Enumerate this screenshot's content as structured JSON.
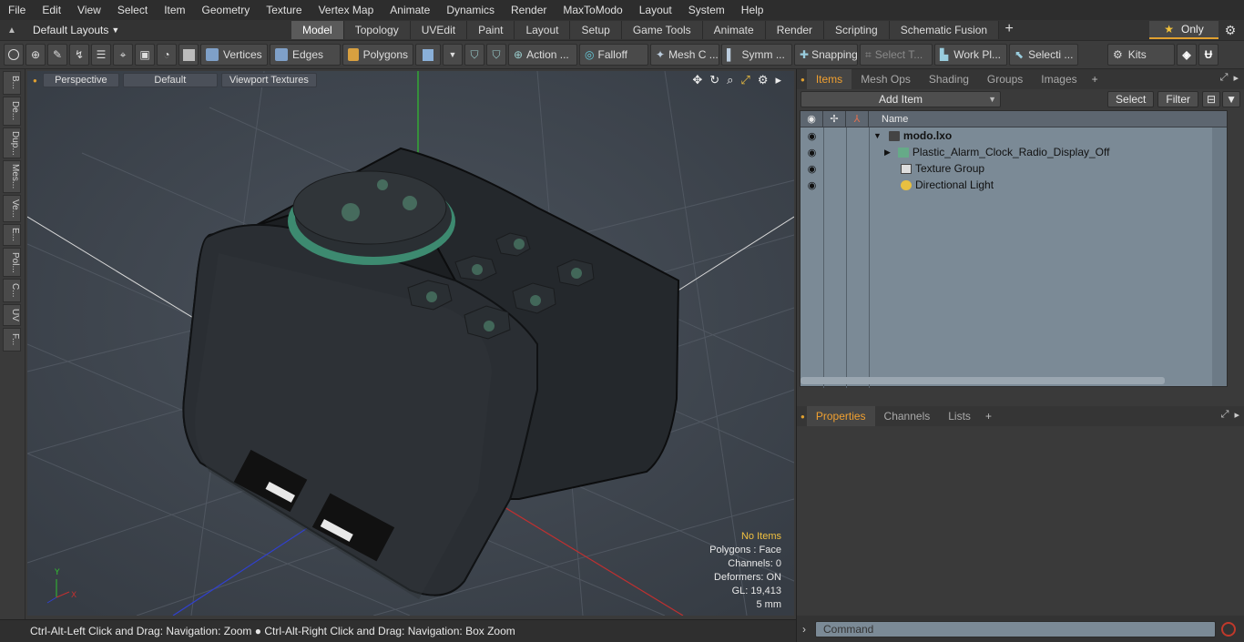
{
  "menu": [
    "File",
    "Edit",
    "View",
    "Select",
    "Item",
    "Geometry",
    "Texture",
    "Vertex Map",
    "Animate",
    "Dynamics",
    "Render",
    "MaxToModo",
    "Layout",
    "System",
    "Help"
  ],
  "layout_selector": "Default Layouts",
  "mode_tabs": [
    "Model",
    "Topology",
    "UVEdit",
    "Paint",
    "Layout",
    "Setup",
    "Game Tools",
    "Animate",
    "Render",
    "Scripting",
    "Schematic Fusion"
  ],
  "active_mode_tab": "Model",
  "only_label": "Only",
  "toolbar": {
    "vertices": "Vertices",
    "edges": "Edges",
    "polygons": "Polygons",
    "action": "Action ...",
    "falloff": "Falloff",
    "mesh_c": "Mesh C ...",
    "symm": "Symm ...",
    "snapping": "Snapping",
    "select_t": "Select T...",
    "work_pl": "Work Pl...",
    "selecti": "Selecti ...",
    "kits": "Kits"
  },
  "left_tabs": [
    "B...",
    "De...",
    "Dup...",
    "Mes...",
    "Ve...",
    "E...",
    "Pol...",
    "C...",
    "UV",
    "F..."
  ],
  "viewport": {
    "perspective": "Perspective",
    "shading": "Default",
    "textures": "Viewport Textures",
    "info": {
      "no_items": "No Items",
      "polygons": "Polygons : Face",
      "channels": "Channels: 0",
      "deformers": "Deformers: ON",
      "gl": "GL: 19,413",
      "scale": "5 mm"
    }
  },
  "status_text": "Ctrl-Alt-Left Click and Drag: Navigation: Zoom ● Ctrl-Alt-Right Click and Drag: Navigation: Box Zoom",
  "items_panel": {
    "tabs": [
      "Items",
      "Mesh Ops",
      "Shading",
      "Groups",
      "Images"
    ],
    "active_tab": "Items",
    "add_item": "Add Item",
    "select": "Select",
    "filter": "Filter",
    "col_name": "Name",
    "tree": [
      {
        "label": "modo.lxo",
        "level": 0
      },
      {
        "label": "Plastic_Alarm_Clock_Radio_Display_Off",
        "level": 1
      },
      {
        "label": "Texture Group",
        "level": 1
      },
      {
        "label": "Directional Light",
        "level": 1
      }
    ]
  },
  "props_panel": {
    "tabs": [
      "Properties",
      "Channels",
      "Lists"
    ],
    "active_tab": "Properties"
  },
  "command_placeholder": "Command",
  "colors": {
    "accent": "#f0a030",
    "grid_x": "#c03030",
    "grid_y": "#30c030",
    "grid_z": "#3040d0"
  }
}
